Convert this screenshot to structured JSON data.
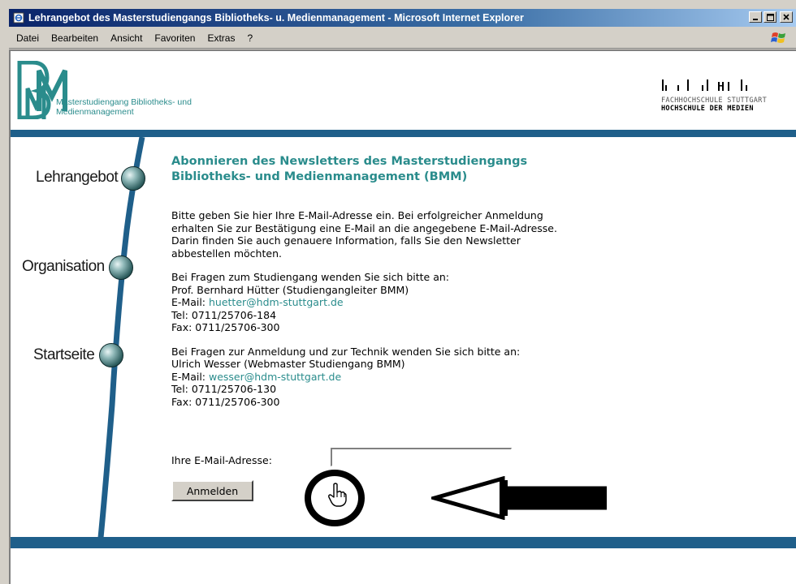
{
  "window": {
    "title": "Lehrangebot des Masterstudiengangs Bibliotheks- u. Medienmanagement - Microsoft Internet Explorer",
    "min_label": "_",
    "max_label": "□",
    "close_label": "×"
  },
  "menu": {
    "items": [
      "Datei",
      "Bearbeiten",
      "Ansicht",
      "Favoriten",
      "Extras",
      "?"
    ]
  },
  "header": {
    "logo_letters": "BMM",
    "logo_sub_line1": "Masterstudiengang Bibliotheks- und",
    "logo_sub_line2": "Medienmanagement",
    "hdm_line1": "FACHHOCHSCHULE STUTTGART",
    "hdm_line2": "HOCHSCHULE DER MEDIEN"
  },
  "nav": {
    "items": [
      "Lehrangebot",
      "Organisation",
      "Startseite"
    ]
  },
  "content": {
    "heading_line1": "Abonnieren des Newsletters des Masterstudiengangs",
    "heading_line2": "Bibliotheks- und Medienmanagement (BMM)",
    "intro": "Bitte geben Sie hier Ihre E-Mail-Adresse ein. Bei erfolgreicher Anmeldung\nerhalten Sie zur Bestätigung eine E-Mail an die angegebene E-Mail-Adresse.\nDarin finden Sie auch genauere Information, falls Sie den Newsletter\nabbestellen möchten.",
    "contact1": {
      "intro": "Bei Fragen zum Studiengang wenden Sie sich bitte an:",
      "name": "Prof. Bernhard Hütter (Studiengangleiter BMM)",
      "email_label": "E-Mail: ",
      "email": "huetter@hdm-stuttgart.de",
      "tel": "Tel: 0711/25706-184",
      "fax": "Fax: 0711/25706-300"
    },
    "contact2": {
      "intro": "Bei Fragen zur Anmeldung und zur Technik wenden Sie sich bitte an:",
      "name": "Ulrich Wesser (Webmaster Studiengang BMM)",
      "email_label": "E-Mail: ",
      "email": "wesser@hdm-stuttgart.de",
      "tel": "Tel: 0711/25706-130",
      "fax": "Fax: 0711/25706-300"
    }
  },
  "form": {
    "email_label": "Ihre E-Mail-Adresse:",
    "email_value": "",
    "submit_label": "Anmelden"
  },
  "colors": {
    "accent": "#2a8c8c",
    "band": "#1f5f8a",
    "title_bar": "#0a246a"
  }
}
